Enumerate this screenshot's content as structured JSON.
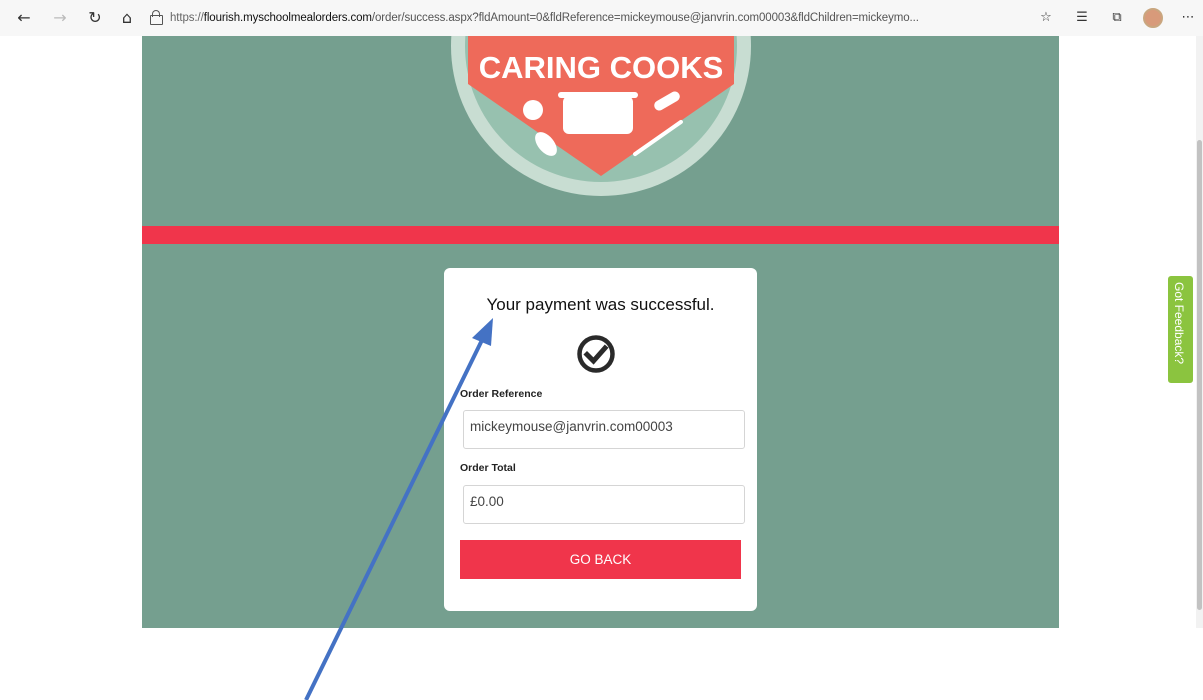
{
  "browser": {
    "url_scheme": "https://",
    "url_host": "flourish.myschoolmealorders.com",
    "url_path": "/order/success.aspx?fldAmount=0&fldReference=mickeymouse@janvrin.com00003&fldChildren=mickeymo..."
  },
  "page": {
    "logo_text": "CARING COOKS",
    "card": {
      "title": "Your payment was successful.",
      "order_reference_label": "Order Reference",
      "order_reference_value": "mickeymouse@janvrin.com00003",
      "order_total_label": "Order Total",
      "order_total_value": "£0.00",
      "go_back_label": "GO BACK"
    }
  },
  "feedback": {
    "label": "Got Feedback?"
  },
  "colors": {
    "page_bg": "#759f8f",
    "accent_red": "#f0354b",
    "feedback_green": "#8bc43f",
    "annotation_arrow": "#4472c4"
  }
}
